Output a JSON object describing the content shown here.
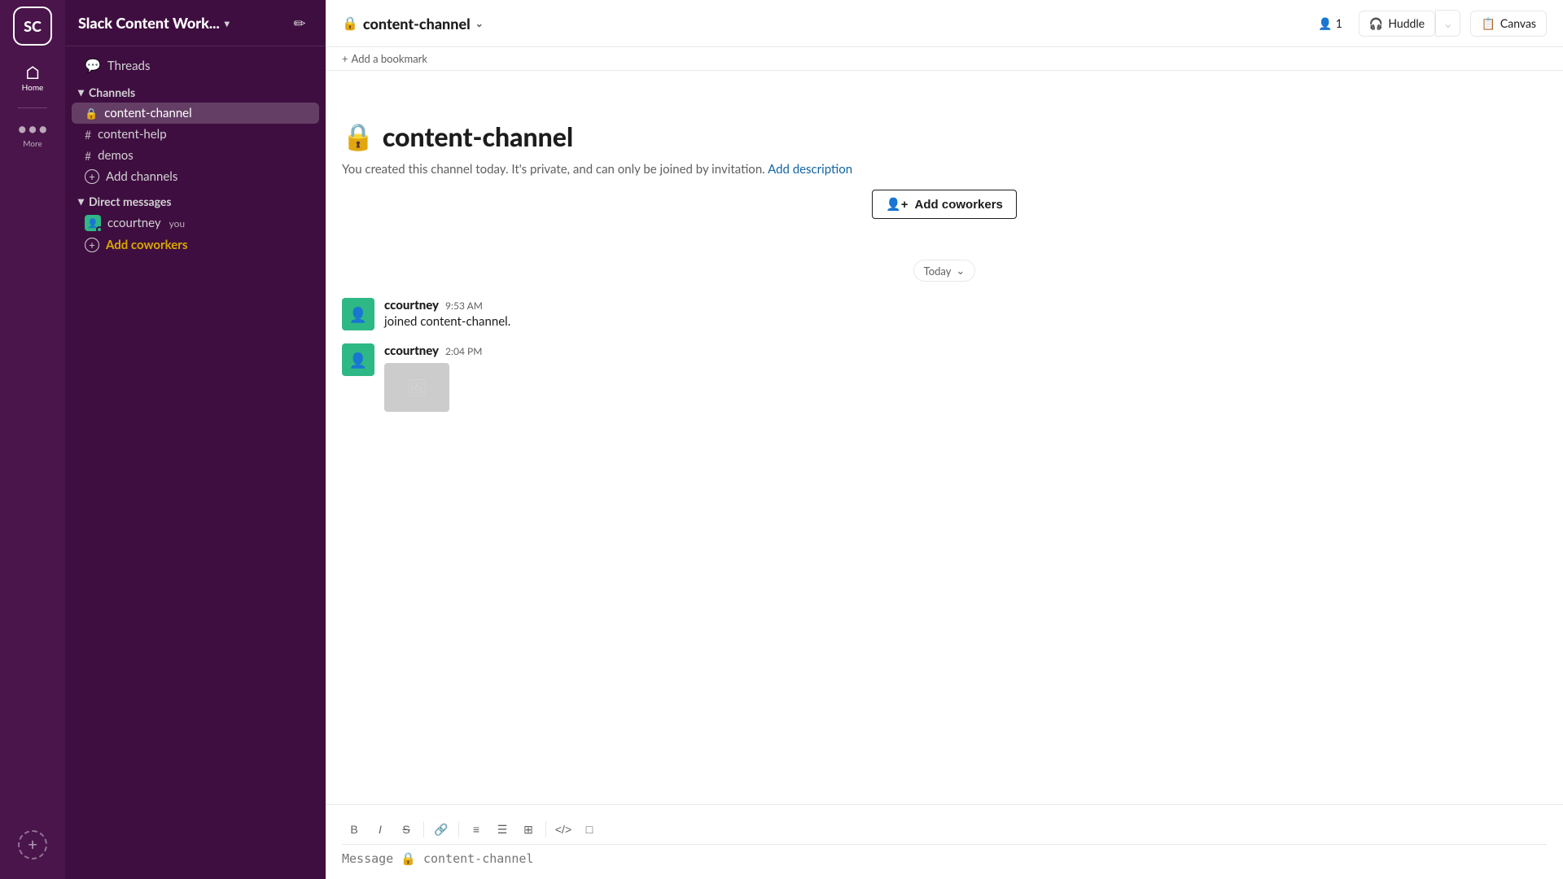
{
  "workspace": {
    "initials": "SC",
    "name": "Slack Content Work...",
    "dropdown_arrow": "▾"
  },
  "rail": {
    "home_label": "Home",
    "more_label": "More",
    "add_label": "+"
  },
  "sidebar": {
    "threads_label": "Threads",
    "channels_section": "Channels",
    "direct_messages_section": "Direct messages",
    "channels": [
      {
        "name": "content-channel",
        "type": "lock",
        "active": true
      },
      {
        "name": "content-help",
        "type": "hash",
        "active": false
      },
      {
        "name": "demos",
        "type": "hash",
        "active": false
      }
    ],
    "add_channels_label": "Add channels",
    "direct_messages": [
      {
        "name": "ccourtney",
        "you": true
      }
    ],
    "add_coworkers_label": "Add coworkers"
  },
  "header": {
    "channel_name": "content-channel",
    "member_count": "1",
    "huddle_label": "Huddle",
    "canvas_label": "Canvas",
    "bookmark_label": "Add a bookmark"
  },
  "channel_intro": {
    "title": "content-channel",
    "description": "You created this channel today. It's private, and can only be joined by invitation.",
    "add_description_link": "Add description",
    "add_coworkers_btn": "Add coworkers"
  },
  "today_divider": {
    "label": "Today",
    "chevron": "⌄"
  },
  "messages": [
    {
      "author": "ccourtney",
      "time": "9:53 AM",
      "text": "joined content-channel.",
      "has_image": false
    },
    {
      "author": "ccourtney",
      "time": "2:04 PM",
      "text": "",
      "has_image": true
    }
  ],
  "composer": {
    "placeholder": "Message 🔒 content-channel",
    "tools": [
      "B",
      "I",
      "S",
      "🔗",
      "≡",
      "☰",
      "⊞",
      "</>",
      "□"
    ]
  }
}
